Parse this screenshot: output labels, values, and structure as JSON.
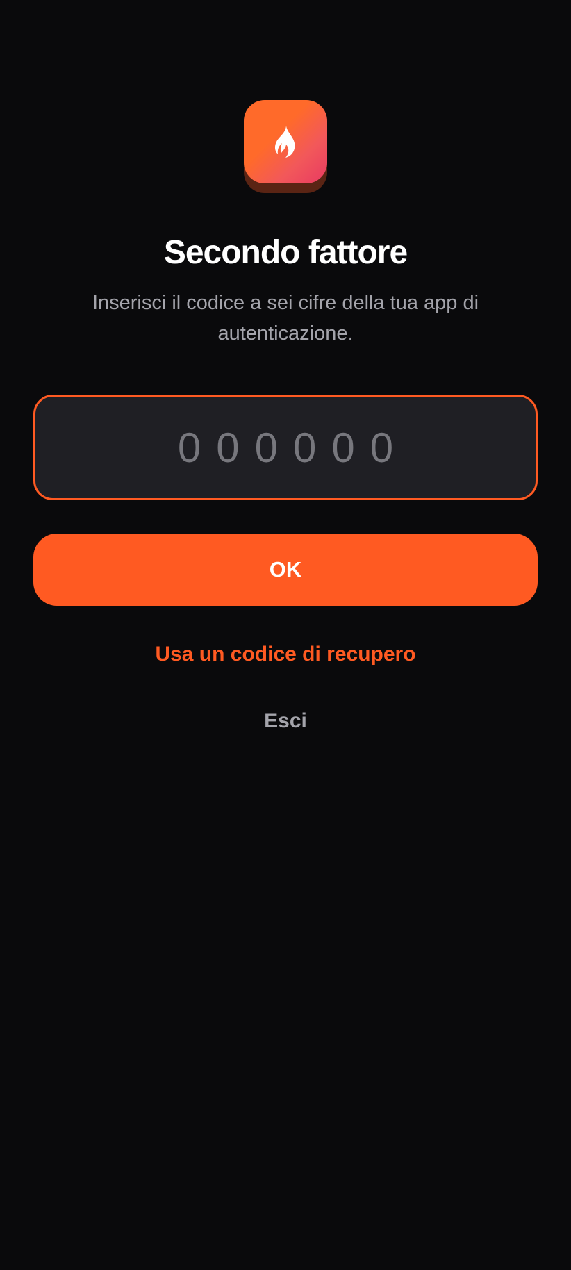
{
  "app": {
    "logo_icon": "flame-icon",
    "accent_color": "#ff5a22"
  },
  "screen": {
    "title": "Secondo fattore",
    "subtitle": "Inserisci il codice a sei cifre della tua app di autenticazione."
  },
  "code_input": {
    "value": "",
    "placeholder": "000000"
  },
  "actions": {
    "ok_label": "OK",
    "recovery_label": "Usa un codice di recupero",
    "exit_label": "Esci"
  }
}
